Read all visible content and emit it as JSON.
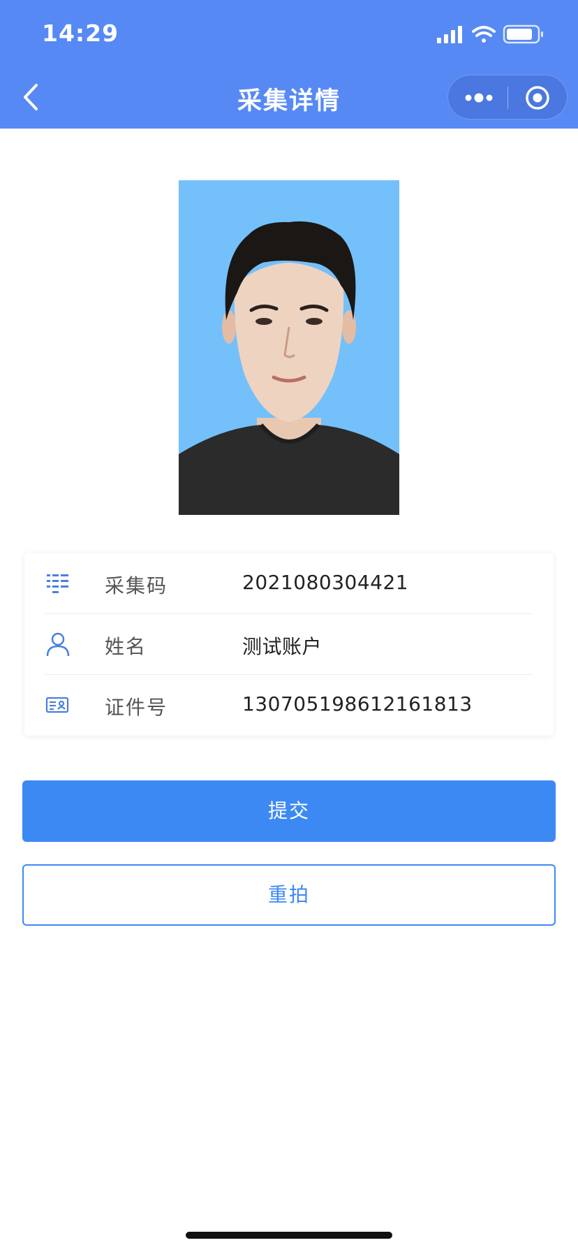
{
  "status_bar": {
    "time": "14:29",
    "icons": [
      "cellular-signal-icon",
      "wifi-icon",
      "battery-icon"
    ]
  },
  "nav": {
    "title": "采集详情",
    "back_icon": "chevron-left-icon",
    "capsule_icons": [
      "more-dots-icon",
      "close-target-icon"
    ]
  },
  "photo": {
    "description_icon": "portrait-photo",
    "background_color": "#74c0fb"
  },
  "info": {
    "rows": [
      {
        "icon": "list-icon",
        "label": "采集码",
        "value": "2021080304421"
      },
      {
        "icon": "user-icon",
        "label": "姓名",
        "value": "测试账户"
      },
      {
        "icon": "id-card-icon",
        "label": "证件号",
        "value": "130705198612161813"
      }
    ]
  },
  "actions": {
    "submit_label": "提交",
    "retake_label": "重拍"
  },
  "colors": {
    "header": "#5689f4",
    "primary": "#3d89f4",
    "icon_accent": "#4a7fe0"
  }
}
